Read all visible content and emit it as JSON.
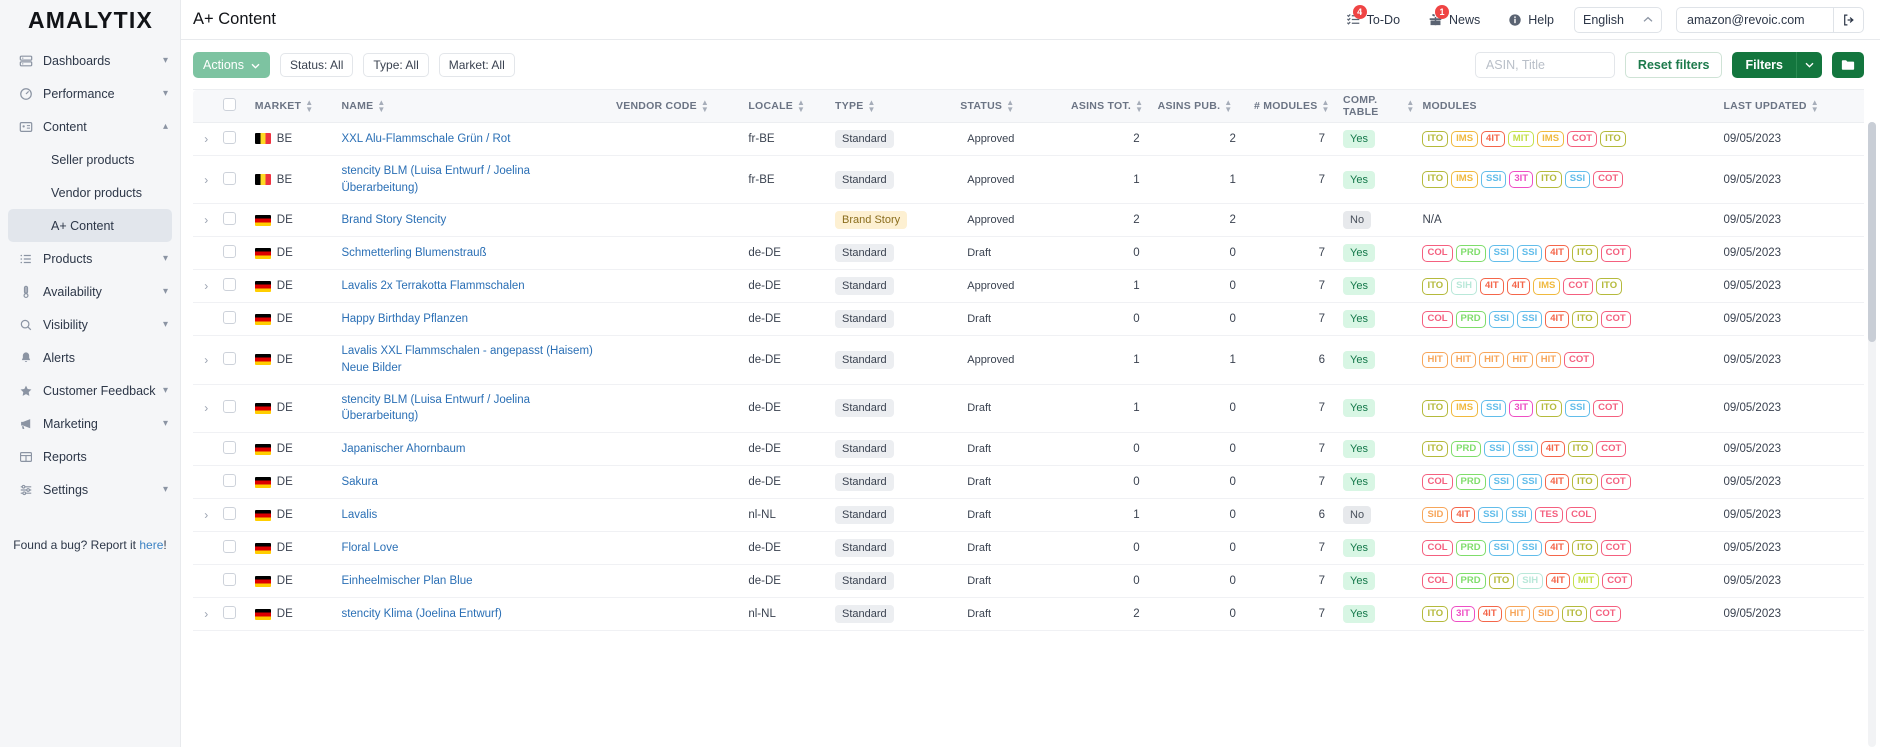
{
  "brand": {
    "logo": "AMALYTIX"
  },
  "sidebar": {
    "items": [
      {
        "label": "Dashboards",
        "icon": "dashboard-icon",
        "chevron": "▾"
      },
      {
        "label": "Performance",
        "icon": "speedometer-icon",
        "chevron": "▾"
      },
      {
        "label": "Content",
        "icon": "content-card-icon",
        "chevron": "▴"
      }
    ],
    "content_children": [
      {
        "label": "Seller products",
        "active": false
      },
      {
        "label": "Vendor products",
        "active": false
      },
      {
        "label": "A+ Content",
        "active": true
      }
    ],
    "items_after": [
      {
        "label": "Products",
        "icon": "list-icon",
        "chevron": "▾"
      },
      {
        "label": "Availability",
        "icon": "thermometer-icon",
        "chevron": "▾"
      },
      {
        "label": "Visibility",
        "icon": "search-icon",
        "chevron": "▾"
      },
      {
        "label": "Alerts",
        "icon": "bell-icon",
        "chevron": ""
      },
      {
        "label": "Customer Feedback",
        "icon": "star-icon",
        "chevron": "▾"
      },
      {
        "label": "Marketing",
        "icon": "megaphone-icon",
        "chevron": "▾"
      },
      {
        "label": "Reports",
        "icon": "table-icon",
        "chevron": ""
      },
      {
        "label": "Settings",
        "icon": "sliders-icon",
        "chevron": "▾"
      }
    ],
    "bug_prefix": "Found a bug? Report it ",
    "bug_link": "here",
    "bug_suffix": "!"
  },
  "header": {
    "title": "A+ Content",
    "todo": {
      "label": "To-Do",
      "badge": "4",
      "icon": "tasks-icon"
    },
    "news": {
      "label": "News",
      "badge": "1",
      "icon": "gift-icon"
    },
    "help": {
      "label": "Help",
      "icon": "info-icon"
    },
    "language": {
      "value": "English",
      "chevron": "⌃"
    },
    "user": {
      "email": "amazon@revoic.com",
      "logout_icon": "logout-icon"
    }
  },
  "toolbar": {
    "actions_label": "Actions",
    "actions_caret": "⌄",
    "chips": [
      {
        "label": "Status: All"
      },
      {
        "label": "Type: All"
      },
      {
        "label": "Market: All"
      }
    ],
    "search_placeholder": "ASIN, Title",
    "search_value": "",
    "reset_label": "Reset filters",
    "filters_label": "Filters",
    "filters_caret": "⌄",
    "folder_icon": "folder-icon"
  },
  "table": {
    "columns": [
      {
        "key": "market",
        "label": "MARKET",
        "sortable": true
      },
      {
        "key": "name",
        "label": "NAME",
        "sortable": true
      },
      {
        "key": "vendor_code",
        "label": "VENDOR CODE",
        "sortable": true
      },
      {
        "key": "locale",
        "label": "LOCALE",
        "sortable": true
      },
      {
        "key": "type",
        "label": "TYPE",
        "sortable": true
      },
      {
        "key": "status",
        "label": "STATUS",
        "sortable": true
      },
      {
        "key": "asins_tot",
        "label": "ASINS TOT.",
        "sortable": true
      },
      {
        "key": "asins_pub",
        "label": "ASINS PUB.",
        "sortable": true
      },
      {
        "key": "modules_count",
        "label": "# MODULES",
        "sortable": true
      },
      {
        "key": "comp_table",
        "label": "COMP. TABLE",
        "sortable": true
      },
      {
        "key": "modules",
        "label": "MODULES",
        "sortable": false
      },
      {
        "key": "last_updated",
        "label": "LAST UPDATED",
        "sortable": true
      }
    ],
    "rows": [
      {
        "expandable": true,
        "market": "BE",
        "flag": "be",
        "name": "XXL Alu-Flammschale Grün / Rot",
        "vendor_code": "",
        "locale": "fr-BE",
        "type": "Standard",
        "type_style": "std",
        "status": "Approved",
        "asins_tot": "2",
        "asins_pub": "2",
        "modules_count": "7",
        "comp_table": "Yes",
        "modules": [
          "ITO",
          "IMS",
          "4IT",
          "MIT",
          "IMS",
          "COT",
          "ITO"
        ],
        "last_updated": "09/05/2023"
      },
      {
        "expandable": true,
        "market": "BE",
        "flag": "be",
        "name": "stencity BLM (Luisa Entwurf / Joelina Überarbeitung)",
        "vendor_code": "",
        "locale": "fr-BE",
        "type": "Standard",
        "type_style": "std",
        "status": "Approved",
        "asins_tot": "1",
        "asins_pub": "1",
        "modules_count": "7",
        "comp_table": "Yes",
        "modules": [
          "ITO",
          "IMS",
          "SSI",
          "3IT",
          "ITO",
          "SSI",
          "COT"
        ],
        "last_updated": "09/05/2023"
      },
      {
        "expandable": true,
        "market": "DE",
        "flag": "de",
        "name": "Brand Story Stencity",
        "vendor_code": "",
        "locale": "",
        "type": "Brand Story",
        "type_style": "brandstory",
        "status": "Approved",
        "asins_tot": "2",
        "asins_pub": "2",
        "modules_count": "",
        "comp_table": "No",
        "modules": [],
        "modules_na": "N/A",
        "last_updated": "09/05/2023"
      },
      {
        "expandable": false,
        "market": "DE",
        "flag": "de",
        "name": "Schmetterling Blumenstrauß",
        "vendor_code": "",
        "locale": "de-DE",
        "type": "Standard",
        "type_style": "std",
        "status": "Draft",
        "asins_tot": "0",
        "asins_pub": "0",
        "modules_count": "7",
        "comp_table": "Yes",
        "modules": [
          "COL",
          "PRD",
          "SSI",
          "SSI",
          "4IT",
          "ITO",
          "COT"
        ],
        "last_updated": "09/05/2023"
      },
      {
        "expandable": true,
        "market": "DE",
        "flag": "de",
        "name": "Lavalis 2x Terrakotta Flammschalen",
        "vendor_code": "",
        "locale": "de-DE",
        "type": "Standard",
        "type_style": "std",
        "status": "Approved",
        "asins_tot": "1",
        "asins_pub": "0",
        "modules_count": "7",
        "comp_table": "Yes",
        "modules": [
          "ITO",
          "SIH",
          "4IT",
          "4IT",
          "IMS",
          "COT",
          "ITO"
        ],
        "last_updated": "09/05/2023"
      },
      {
        "expandable": false,
        "market": "DE",
        "flag": "de",
        "name": "Happy Birthday Pflanzen",
        "vendor_code": "",
        "locale": "de-DE",
        "type": "Standard",
        "type_style": "std",
        "status": "Draft",
        "asins_tot": "0",
        "asins_pub": "0",
        "modules_count": "7",
        "comp_table": "Yes",
        "modules": [
          "COL",
          "PRD",
          "SSI",
          "SSI",
          "4IT",
          "ITO",
          "COT"
        ],
        "last_updated": "09/05/2023"
      },
      {
        "expandable": true,
        "market": "DE",
        "flag": "de",
        "name": "Lavalis XXL Flammschalen - angepasst (Haisem) Neue Bilder",
        "vendor_code": "",
        "locale": "de-DE",
        "type": "Standard",
        "type_style": "std",
        "status": "Approved",
        "asins_tot": "1",
        "asins_pub": "1",
        "modules_count": "6",
        "comp_table": "Yes",
        "modules": [
          "HIT",
          "HIT",
          "HIT",
          "HIT",
          "HIT",
          "COT"
        ],
        "last_updated": "09/05/2023"
      },
      {
        "expandable": true,
        "market": "DE",
        "flag": "de",
        "name": "stencity BLM (Luisa Entwurf / Joelina Überarbeitung)",
        "vendor_code": "",
        "locale": "de-DE",
        "type": "Standard",
        "type_style": "std",
        "status": "Draft",
        "asins_tot": "1",
        "asins_pub": "0",
        "modules_count": "7",
        "comp_table": "Yes",
        "modules": [
          "ITO",
          "IMS",
          "SSI",
          "3IT",
          "ITO",
          "SSI",
          "COT"
        ],
        "last_updated": "09/05/2023"
      },
      {
        "expandable": false,
        "market": "DE",
        "flag": "de",
        "name": "Japanischer Ahornbaum",
        "vendor_code": "",
        "locale": "de-DE",
        "type": "Standard",
        "type_style": "std",
        "status": "Draft",
        "asins_tot": "0",
        "asins_pub": "0",
        "modules_count": "7",
        "comp_table": "Yes",
        "modules": [
          "ITO",
          "PRD",
          "SSI",
          "SSI",
          "4IT",
          "ITO",
          "COT"
        ],
        "last_updated": "09/05/2023"
      },
      {
        "expandable": false,
        "market": "DE",
        "flag": "de",
        "name": "Sakura",
        "vendor_code": "",
        "locale": "de-DE",
        "type": "Standard",
        "type_style": "std",
        "status": "Draft",
        "asins_tot": "0",
        "asins_pub": "0",
        "modules_count": "7",
        "comp_table": "Yes",
        "modules": [
          "COL",
          "PRD",
          "SSI",
          "SSI",
          "4IT",
          "ITO",
          "COT"
        ],
        "last_updated": "09/05/2023"
      },
      {
        "expandable": true,
        "market": "DE",
        "flag": "de",
        "name": "Lavalis",
        "vendor_code": "",
        "locale": "nl-NL",
        "type": "Standard",
        "type_style": "std",
        "status": "Draft",
        "asins_tot": "1",
        "asins_pub": "0",
        "modules_count": "6",
        "comp_table": "No",
        "modules": [
          "SID",
          "4IT",
          "SSI",
          "SSI",
          "TES",
          "COL"
        ],
        "last_updated": "09/05/2023"
      },
      {
        "expandable": false,
        "market": "DE",
        "flag": "de",
        "name": "Floral Love",
        "vendor_code": "",
        "locale": "de-DE",
        "type": "Standard",
        "type_style": "std",
        "status": "Draft",
        "asins_tot": "0",
        "asins_pub": "0",
        "modules_count": "7",
        "comp_table": "Yes",
        "modules": [
          "COL",
          "PRD",
          "SSI",
          "SSI",
          "4IT",
          "ITO",
          "COT"
        ],
        "last_updated": "09/05/2023"
      },
      {
        "expandable": false,
        "market": "DE",
        "flag": "de",
        "name": "Einheelmischer Plan Blue",
        "vendor_code": "",
        "locale": "de-DE",
        "type": "Standard",
        "type_style": "std",
        "status": "Draft",
        "asins_tot": "0",
        "asins_pub": "0",
        "modules_count": "7",
        "comp_table": "Yes",
        "modules": [
          "COL",
          "PRD",
          "ITO",
          "SIH",
          "4IT",
          "MIT",
          "COT"
        ],
        "last_updated": "09/05/2023"
      },
      {
        "expandable": true,
        "market": "DE",
        "flag": "de",
        "name": "stencity Klima (Joelina Entwurf)",
        "vendor_code": "",
        "locale": "nl-NL",
        "type": "Standard",
        "type_style": "std",
        "status": "Draft",
        "asins_tot": "2",
        "asins_pub": "0",
        "modules_count": "7",
        "comp_table": "Yes",
        "modules": [
          "ITO",
          "3IT",
          "4IT",
          "HIT",
          "SID",
          "ITO",
          "COT"
        ],
        "last_updated": "09/05/2023"
      }
    ]
  },
  "module_colors": {
    "ITO": "#b5ba3c",
    "IMS": "#f0b93e",
    "4IT": "#f4664a",
    "MIT": "#c4e04a",
    "COT": "#f4607f",
    "SSI": "#62bdea",
    "3IT": "#ee4fc4",
    "COL": "#f4607f",
    "PRD": "#7fdd6b",
    "SIH": "#b9e8d9",
    "HIT": "#f7a65a",
    "SID": "#f7a65a",
    "TES": "#f4607f"
  },
  "theme": {
    "accent_green": "#13763e",
    "actions_green": "#7dc3a1",
    "link_blue": "#2a6fb5",
    "badge_red": "#ef4444"
  }
}
